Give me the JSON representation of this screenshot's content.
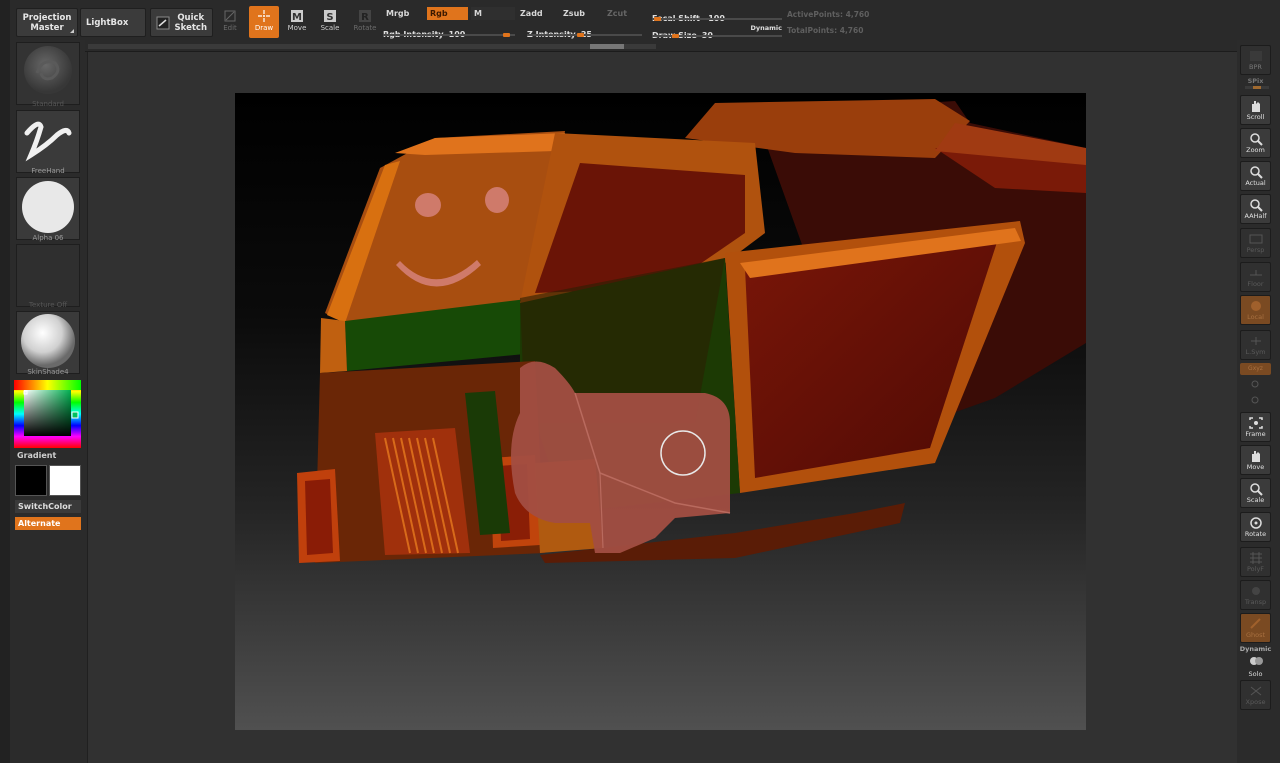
{
  "colors": {
    "accent": "#e0741c",
    "panel": "#2b2b2b",
    "button": "#3b3b3b"
  },
  "topbar": {
    "projection_master": [
      "Projection",
      "Master"
    ],
    "lightbox": "LightBox",
    "quick_sketch": [
      "Quick",
      "Sketch"
    ],
    "tools": [
      {
        "label": "Edit",
        "icon": "edit-icon",
        "state": "dim"
      },
      {
        "label": "Draw",
        "icon": "draw-icon",
        "state": "active"
      },
      {
        "label": "Move",
        "icon": "move-icon",
        "state": "normal"
      },
      {
        "label": "Scale",
        "icon": "scale-icon",
        "state": "normal"
      },
      {
        "label": "Rotate",
        "icon": "rotate-icon",
        "state": "dim"
      }
    ],
    "modes": {
      "mrgb": "Mrgb",
      "rgb": "Rgb",
      "m": "M",
      "zadd": "Zadd",
      "zsub": "Zsub",
      "zcut": "Zcut"
    },
    "rgb_intensity": {
      "label": "Rgb Intensity",
      "value": 100
    },
    "z_intensity": {
      "label": "Z Intensity",
      "value": 25
    },
    "focal_shift": {
      "label": "Focal Shift",
      "value": -100
    },
    "draw_size": {
      "label": "Draw Size",
      "value": 30
    },
    "dynamic": "Dynamic",
    "active_points": {
      "label": "ActivePoints:",
      "value": "4,760"
    },
    "total_points": {
      "label": "TotalPoints:",
      "value": "4,760"
    }
  },
  "left": {
    "brush": "Standard",
    "stroke": "FreeHand",
    "alpha": "Alpha 06",
    "texture": "Texture Off",
    "material": "SkinShade4",
    "gradient": "Gradient",
    "switch_color": "SwitchColor",
    "alternate": "Alternate"
  },
  "right": {
    "bpr": "BPR",
    "spix": "SPix",
    "buttons": [
      {
        "label": "Scroll",
        "icon": "hand-scroll-icon",
        "state": "normal"
      },
      {
        "label": "Zoom",
        "icon": "zoom-icon",
        "state": "normal"
      },
      {
        "label": "Actual",
        "icon": "actual-size-icon",
        "state": "normal"
      },
      {
        "label": "AAHalf",
        "icon": "aahalf-icon",
        "state": "normal"
      },
      {
        "label": "Persp",
        "icon": "perspective-icon",
        "state": "dim"
      },
      {
        "label": "Floor",
        "icon": "floor-icon",
        "state": "dim"
      },
      {
        "label": "Local",
        "icon": "local-icon",
        "state": "orange"
      },
      {
        "label": "L.Sym",
        "icon": "lsym-icon",
        "state": "dim"
      }
    ],
    "xyz": "Gxyz",
    "lower_buttons": [
      {
        "label": "Frame",
        "icon": "frame-icon",
        "state": "normal"
      },
      {
        "label": "Move",
        "icon": "move-hand-icon",
        "state": "normal"
      },
      {
        "label": "Scale",
        "icon": "scale-icon",
        "state": "normal"
      },
      {
        "label": "Rotate",
        "icon": "rotate-icon",
        "state": "normal"
      },
      {
        "label": "PolyF",
        "icon": "polyframe-icon",
        "state": "dim"
      },
      {
        "label": "Transp",
        "icon": "transparency-icon",
        "state": "dim"
      },
      {
        "label": "Ghost",
        "icon": "ghost-icon",
        "state": "orange"
      }
    ],
    "dynamic": "Dynamic",
    "solo": "Solo",
    "xpose": "Xpose"
  }
}
